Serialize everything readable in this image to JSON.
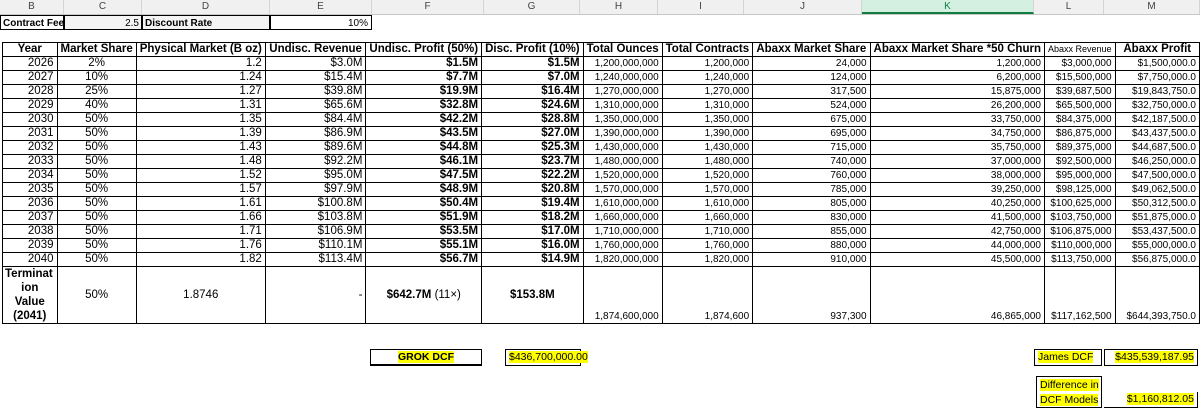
{
  "column_letters": [
    "B",
    "C",
    "D",
    "E",
    "F",
    "G",
    "H",
    "I",
    "J",
    "K",
    "L",
    "M"
  ],
  "selected_column": "K",
  "top_row": {
    "contract_fee_label": "Contract Fee",
    "contract_fee_value": "2.5",
    "discount_rate_label": "Discount Rate",
    "discount_rate_value": "10%"
  },
  "table": {
    "headers": [
      "Year",
      "Market Share",
      "Physical Market (B oz)",
      "Undisc. Revenue",
      "Undisc. Profit (50%)",
      "Disc. Profit (10%)",
      "Total Ounces",
      "Total Contracts",
      "Abaxx Market Share",
      "Abaxx Market Share *50 Churn",
      "Abaxx Revenue",
      "Abaxx Profit"
    ],
    "rows": [
      [
        "2026",
        "2%",
        "1.2",
        "$3.0M",
        "$1.5M",
        "$1.5M",
        "1,200,000,000",
        "1,200,000",
        "24,000",
        "1,200,000",
        "$3,000,000",
        "$1,500,000.0"
      ],
      [
        "2027",
        "10%",
        "1.24",
        "$15.4M",
        "$7.7M",
        "$7.0M",
        "1,240,000,000",
        "1,240,000",
        "124,000",
        "6,200,000",
        "$15,500,000",
        "$7,750,000.0"
      ],
      [
        "2028",
        "25%",
        "1.27",
        "$39.8M",
        "$19.9M",
        "$16.4M",
        "1,270,000,000",
        "1,270,000",
        "317,500",
        "15,875,000",
        "$39,687,500",
        "$19,843,750.0"
      ],
      [
        "2029",
        "40%",
        "1.31",
        "$65.6M",
        "$32.8M",
        "$24.6M",
        "1,310,000,000",
        "1,310,000",
        "524,000",
        "26,200,000",
        "$65,500,000",
        "$32,750,000.0"
      ],
      [
        "2030",
        "50%",
        "1.35",
        "$84.4M",
        "$42.2M",
        "$28.8M",
        "1,350,000,000",
        "1,350,000",
        "675,000",
        "33,750,000",
        "$84,375,000",
        "$42,187,500.0"
      ],
      [
        "2031",
        "50%",
        "1.39",
        "$86.9M",
        "$43.5M",
        "$27.0M",
        "1,390,000,000",
        "1,390,000",
        "695,000",
        "34,750,000",
        "$86,875,000",
        "$43,437,500.0"
      ],
      [
        "2032",
        "50%",
        "1.43",
        "$89.6M",
        "$44.8M",
        "$25.3M",
        "1,430,000,000",
        "1,430,000",
        "715,000",
        "35,750,000",
        "$89,375,000",
        "$44,687,500.0"
      ],
      [
        "2033",
        "50%",
        "1.48",
        "$92.2M",
        "$46.1M",
        "$23.7M",
        "1,480,000,000",
        "1,480,000",
        "740,000",
        "37,000,000",
        "$92,500,000",
        "$46,250,000.0"
      ],
      [
        "2034",
        "50%",
        "1.52",
        "$95.0M",
        "$47.5M",
        "$22.2M",
        "1,520,000,000",
        "1,520,000",
        "760,000",
        "38,000,000",
        "$95,000,000",
        "$47,500,000.0"
      ],
      [
        "2035",
        "50%",
        "1.57",
        "$97.9M",
        "$48.9M",
        "$20.8M",
        "1,570,000,000",
        "1,570,000",
        "785,000",
        "39,250,000",
        "$98,125,000",
        "$49,062,500.0"
      ],
      [
        "2036",
        "50%",
        "1.61",
        "$100.8M",
        "$50.4M",
        "$19.4M",
        "1,610,000,000",
        "1,610,000",
        "805,000",
        "40,250,000",
        "$100,625,000",
        "$50,312,500.0"
      ],
      [
        "2037",
        "50%",
        "1.66",
        "$103.8M",
        "$51.9M",
        "$18.2M",
        "1,660,000,000",
        "1,660,000",
        "830,000",
        "41,500,000",
        "$103,750,000",
        "$51,875,000.0"
      ],
      [
        "2038",
        "50%",
        "1.71",
        "$106.9M",
        "$53.5M",
        "$17.0M",
        "1,710,000,000",
        "1,710,000",
        "855,000",
        "42,750,000",
        "$106,875,000",
        "$53,437,500.0"
      ],
      [
        "2039",
        "50%",
        "1.76",
        "$110.1M",
        "$55.1M",
        "$16.0M",
        "1,760,000,000",
        "1,760,000",
        "880,000",
        "44,000,000",
        "$110,000,000",
        "$55,000,000.0"
      ],
      [
        "2040",
        "50%",
        "1.82",
        "$113.4M",
        "$56.7M",
        "$14.9M",
        "1,820,000,000",
        "1,820,000",
        "910,000",
        "45,500,000",
        "$113,750,000",
        "$56,875,000.0"
      ]
    ],
    "terminal": {
      "label_lines": [
        "Terminat",
        "ion",
        "Value",
        "(2041)"
      ],
      "market_share": "50%",
      "physical_market": "1.8746",
      "undisc_revenue": "-",
      "undisc_profit": "$642.7M",
      "undisc_profit_note": "(11×)",
      "disc_profit": "$153.8M",
      "total_ounces": "1,874,600,000",
      "total_contracts": "1,874,600",
      "abaxx_market_share": "937,300",
      "abaxx_churn": "46,865,000",
      "abaxx_revenue": "$117,162,500",
      "abaxx_profit": "$644,393,750.0"
    }
  },
  "grok_dcf": {
    "label": "GROK DCF",
    "value": "$436,700,000.00"
  },
  "james_dcf": {
    "label": "James DCF",
    "value": "$435,539,187.95"
  },
  "difference": {
    "label_line1": "Difference in",
    "label_line2": "DCF Models",
    "value": "$1,160,812.05"
  }
}
